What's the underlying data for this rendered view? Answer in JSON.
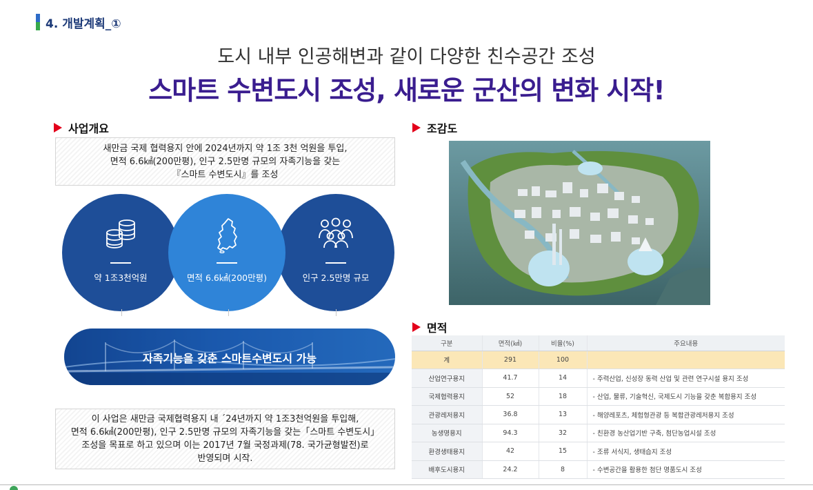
{
  "section_tag": "4. 개발계획_①",
  "subtitle": "도시 내부 인공해변과 같이 다양한 친수공간 조성",
  "headline": "스마트 수변도시 조성, 새로운 군산의 변화 시작!",
  "overview": {
    "heading": "사업개요",
    "summary": "새만금 국제 협력용지 안에 2024년까지 약 1조 3천 억원을 투입,\n면적 6.6㎢(200만평), 인구 2.5만명 규모의 자족기능을 갖는\n『스마트 수변도시』를 조성",
    "circles": [
      {
        "label": "약 1조3천억원",
        "icon": "coins-icon"
      },
      {
        "label": "면적 6.6㎢(200만평)",
        "icon": "korea-map-icon"
      },
      {
        "label": "인구 2.5만명 규모",
        "icon": "people-group-icon"
      }
    ],
    "banner": "자족기능을 갖춘 스마트수변도시 가능",
    "description": "이 사업은 새만금 국제협력용지 내 ´24년까지 약 1조3천억원을 투입해,\n면적 6.6㎢(200만평), 인구 2.5만명 규모의 자족기능을 갖는「스마트 수변도시」\n조성을 목표로 하고 있으며 이는 2017년 7월 국정과제(78. 국가균형발전)로\n반영되며 시작."
  },
  "aerial": {
    "heading": "조감도"
  },
  "area": {
    "heading": "면적",
    "columns": [
      "구분",
      "면적(㎢)",
      "비율(%)",
      "주요내용"
    ],
    "total": {
      "name": "계",
      "area": "291",
      "ratio": "100",
      "note": ""
    },
    "rows": [
      {
        "name": "산업연구용지",
        "area": "41.7",
        "ratio": "14",
        "note": "- 주력산업, 신성장 동력 산업 및 관련 연구시설 용지 조성"
      },
      {
        "name": "국제협력용지",
        "area": "52",
        "ratio": "18",
        "note": "- 산업, 물류, 기술혁신, 국제도시 기능을 갖춘 복합용지 조성"
      },
      {
        "name": "관광레저용지",
        "area": "36.8",
        "ratio": "13",
        "note": "- 해양레포츠, 체험형관광 등 복합관광레저용지 조성"
      },
      {
        "name": "농생명용지",
        "area": "94.3",
        "ratio": "32",
        "note": "- 친환경 농산업기반 구축, 첨단농업시설 조성"
      },
      {
        "name": "환경생태용지",
        "area": "42",
        "ratio": "15",
        "note": "- 조류 서식지, 생태습지 조성"
      },
      {
        "name": "배후도시용지",
        "area": "24.2",
        "ratio": "8",
        "note": "- 수변공간을 활용한 첨단 명품도시 조성"
      }
    ]
  },
  "colors": {
    "headline": "#3a1d8f",
    "circle_dark": "#1e4e98",
    "circle_light": "#2f84d8",
    "marker_red": "#e3001b",
    "total_row": "#fbe7b7"
  }
}
